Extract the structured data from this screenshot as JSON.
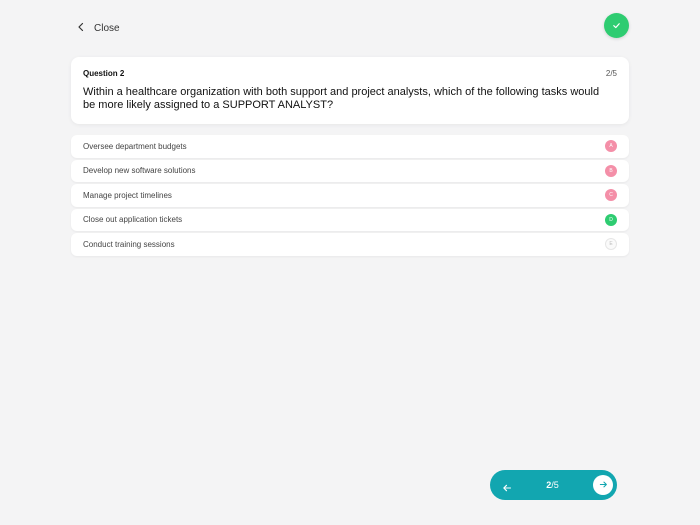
{
  "header": {
    "close_label": "Close",
    "status_icon": "check-icon",
    "status_color": "#2ecc71"
  },
  "question": {
    "label": "Question 2",
    "counter": "2/5",
    "text": "Within a healthcare organization with both support and project analysts, which of the following tasks would be more likely assigned to a SUPPORT ANALYST?"
  },
  "answers": [
    {
      "text": "Oversee department budgets",
      "letter": "A",
      "state": "wrong"
    },
    {
      "text": "Develop new software solutions",
      "letter": "B",
      "state": "wrong"
    },
    {
      "text": "Manage project timelines",
      "letter": "C",
      "state": "wrong"
    },
    {
      "text": "Close out application tickets",
      "letter": "D",
      "state": "right"
    },
    {
      "text": "Conduct training sessions",
      "letter": "E",
      "state": "neutral"
    }
  ],
  "navigator": {
    "current": "2",
    "total": "/5",
    "prev_icon": "arrow-left-icon",
    "next_icon": "arrow-right-icon",
    "accent": "#12a6b0"
  }
}
